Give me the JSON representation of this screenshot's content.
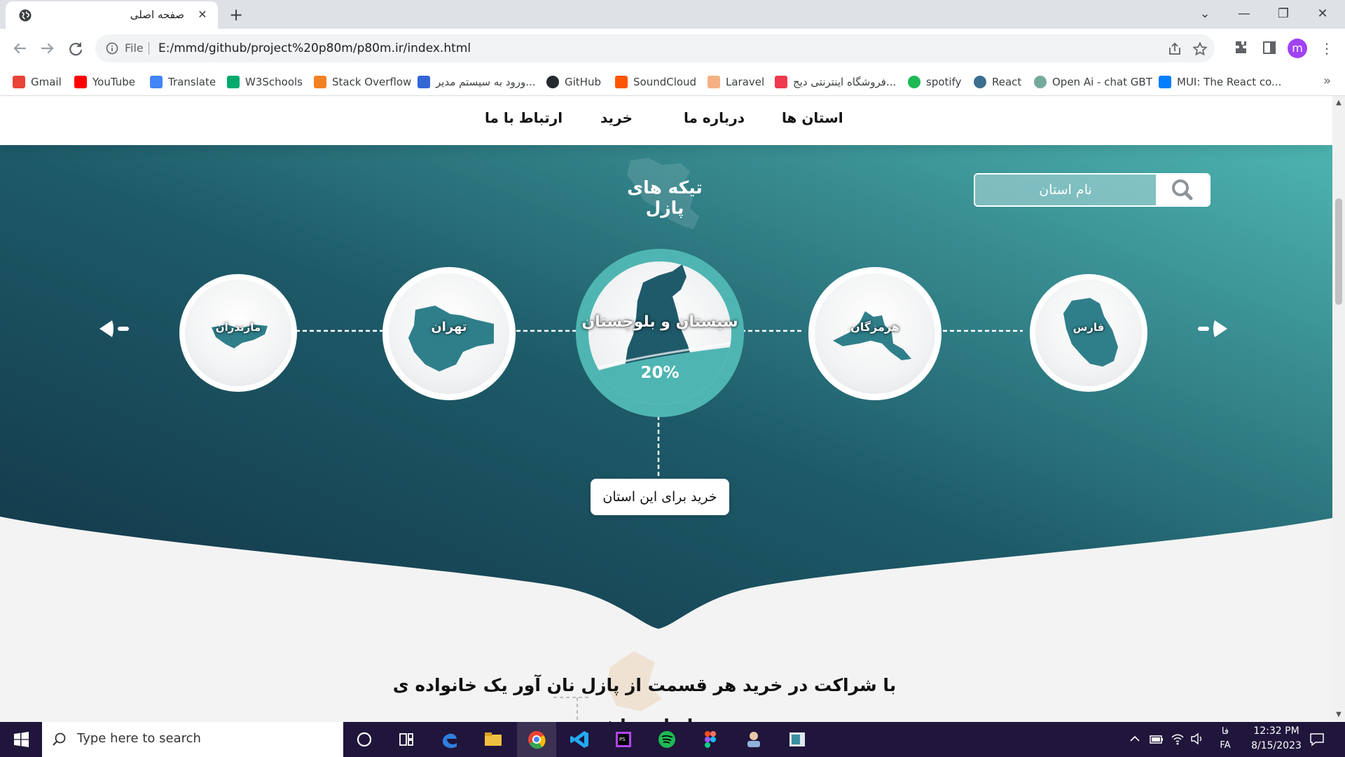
{
  "browser": {
    "tab_title": "صفحه اصلی",
    "new_tab": "+",
    "close_tab": "✕",
    "window_controls": {
      "chevron": "⌄",
      "minimize": "—",
      "restore": "❐",
      "close": "✕"
    },
    "file_label": "File",
    "url": "E:/mmd/github/project%20p80m/p80m.ir/index.html",
    "profile_initial": "m",
    "menu_glyph": "⋮",
    "bookmarks": [
      {
        "label": "Gmail",
        "color": "#ea4335"
      },
      {
        "label": "YouTube",
        "color": "#ff0000"
      },
      {
        "label": "Translate",
        "color": "#4285f4"
      },
      {
        "label": "W3Schools",
        "color": "#04aa6d"
      },
      {
        "label": "Stack Overflow",
        "color": "#f48024"
      },
      {
        "label": "ورود به سیستم مدیر...",
        "color": "#3367d6"
      },
      {
        "label": "GitHub",
        "color": "#24292e"
      },
      {
        "label": "SoundCloud",
        "color": "#ff5500"
      },
      {
        "label": "Laravel",
        "color": "#f4b183"
      },
      {
        "label": "فروشگاه اینترنتی دیج...",
        "color": "#ef394e"
      },
      {
        "label": "spotify",
        "color": "#1db954"
      },
      {
        "label": "React",
        "color": "#3b6e8f"
      },
      {
        "label": "Open Ai - chat GBT",
        "color": "#74aa9c"
      },
      {
        "label": "MUI: The React co...",
        "color": "#007fff"
      }
    ],
    "bookmarks_more": "»"
  },
  "site_nav": {
    "items": [
      "استان ها",
      "درباره ما",
      "خرید",
      "ارتباط با ما"
    ]
  },
  "hero": {
    "search_placeholder": "نام استان",
    "title": "تیکه های پازل",
    "provinces": [
      {
        "name": "مازندران"
      },
      {
        "name": "تهران"
      },
      {
        "name": "سیستان و بلوچستان",
        "percent": "20%",
        "selected": true
      },
      {
        "name": "هرمزگان"
      },
      {
        "name": "فارس"
      }
    ],
    "buy_button": "خرید برای این استان",
    "lower_text": "با شراکت در خرید هر قسمت از پازل نان آور یک خانواده ی ایرانی باش"
  },
  "colors": {
    "hero_dark": "#153e52",
    "hero_light": "#4fb8b5",
    "accent": "#4fb5b2",
    "map_fill": "#2f7f8b"
  },
  "taskbar": {
    "search_placeholder": "Type here to search",
    "apps": [
      "cortana-icon",
      "task-view-icon",
      "edge-icon",
      "file-explorer-icon",
      "chrome-icon",
      "vscode-icon",
      "phpstorm-icon",
      "spotify-icon",
      "figma-icon",
      "user-app-icon",
      "media-app-icon"
    ],
    "ime_top": "فا",
    "lang": "FA",
    "time": "12:32 PM",
    "date": "8/15/2023"
  }
}
